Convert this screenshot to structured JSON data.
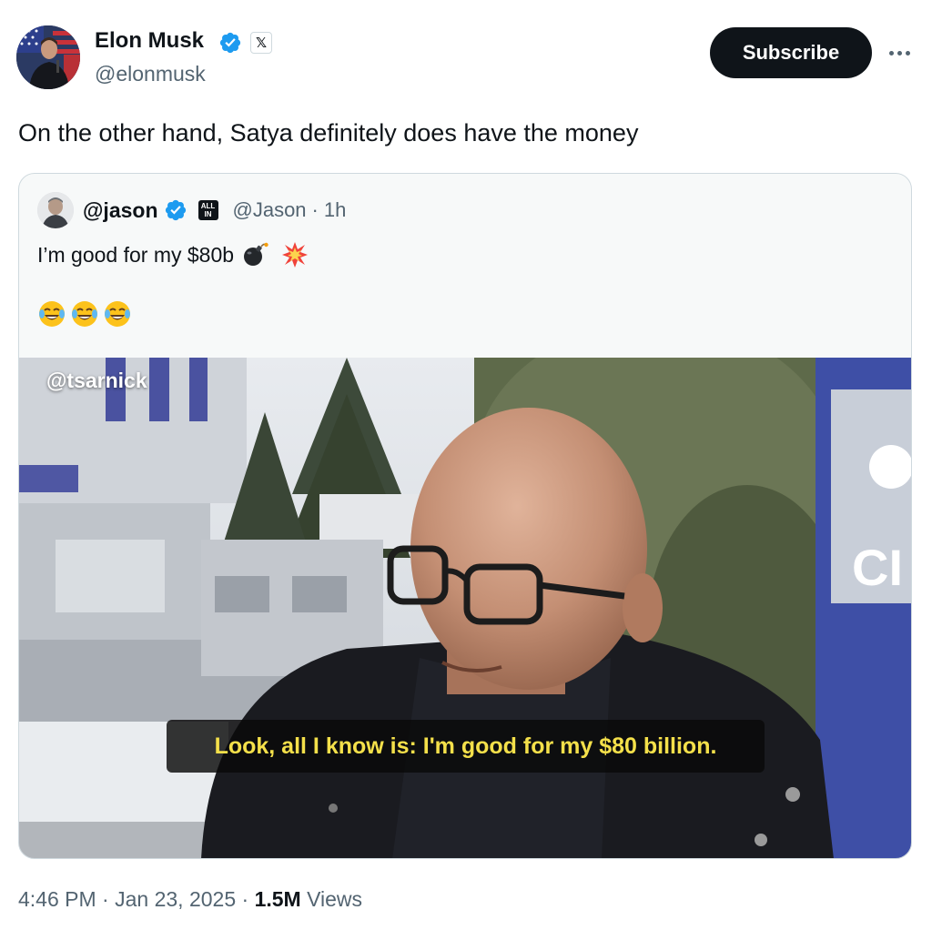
{
  "author": {
    "name": "Elon Musk",
    "handle": "@elonmusk",
    "verified_color": "#1d9bf0"
  },
  "header": {
    "subscribe_label": "Subscribe",
    "more_icon": "more-horizontal-icon"
  },
  "tweet": {
    "text": "On the other hand, Satya definitely does have the money"
  },
  "quote": {
    "name": "@jason",
    "handle": "@Jason",
    "separator": "·",
    "time": "1h",
    "badge": "ALL IN",
    "text": "I’m good for my $80b",
    "text_emojis": [
      "bomb-icon",
      "explosion-icon"
    ],
    "reaction_emojis": [
      "laughing-crying-icon",
      "laughing-crying-icon",
      "laughing-crying-icon"
    ],
    "media": {
      "watermark": "@tsarnick",
      "caption": "Look, all I know is: I'm good for my $80 billion.",
      "caption_color": "#f4e04a"
    }
  },
  "footer": {
    "time": "4:46 PM",
    "date": "Jan 23, 2025",
    "separator": "·",
    "views_count": "1.5M",
    "views_label": "Views"
  }
}
